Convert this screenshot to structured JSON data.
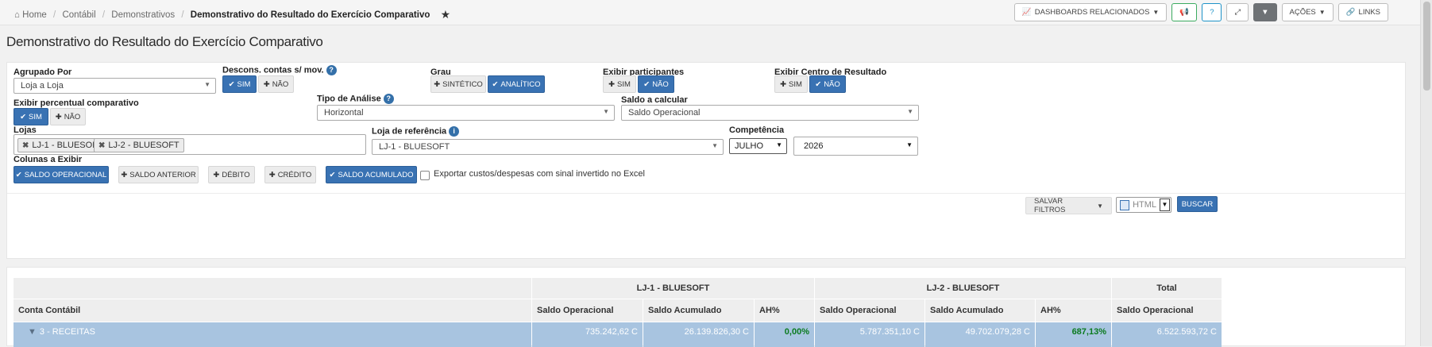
{
  "breadcrumb": {
    "home_icon": "home-icon",
    "items": [
      "Home",
      "Contábil",
      "Demonstrativos"
    ],
    "current": "Demonstrativo do Resultado do Exercício Comparativo",
    "star_icon": "star-icon"
  },
  "toolbar": {
    "dashboards_label": "DASHBOARDS RELACIONADOS",
    "acoes_label": "AÇÕES",
    "links_label": "LINKS"
  },
  "page_title": "Demonstrativo do Resultado do Exercício Comparativo",
  "filters": {
    "agrupado_por": {
      "label": "Agrupado Por",
      "value": "Loja a Loja"
    },
    "descons": {
      "label": "Descons. contas s/ mov.",
      "sim": "SIM",
      "nao": "NÃO",
      "selected": "SIM"
    },
    "grau": {
      "label": "Grau",
      "sintetico": "SINTÉTICO",
      "analitico": "ANALÍTICO",
      "selected": "ANALÍTICO"
    },
    "exibir_participantes": {
      "label": "Exibir participantes",
      "sim": "SIM",
      "nao": "NÃO",
      "selected": "NÃO"
    },
    "exibir_centro": {
      "label": "Exibir Centro de Resultado",
      "sim": "SIM",
      "nao": "NÃO",
      "selected": "NÃO"
    },
    "exibir_percentual": {
      "label": "Exibir percentual comparativo",
      "sim": "SIM",
      "nao": "NÃO",
      "selected": "SIM"
    },
    "tipo_analise": {
      "label": "Tipo de Análise",
      "value": "Horizontal"
    },
    "saldo_calcular": {
      "label": "Saldo a calcular",
      "value": "Saldo Operacional"
    },
    "lojas": {
      "label": "Lojas",
      "tags": [
        "LJ-1 - BLUESOFT",
        "LJ-2 - BLUESOFT"
      ]
    },
    "loja_referencia": {
      "label": "Loja de referência",
      "value": "LJ-1 - BLUESOFT"
    },
    "competencia": {
      "label": "Competência",
      "month": "JULHO",
      "year": "2026"
    },
    "colunas": {
      "label": "Colunas a Exibir",
      "items": [
        {
          "label": "SALDO OPERACIONAL",
          "active": true
        },
        {
          "label": "SALDO ANTERIOR",
          "active": false
        },
        {
          "label": "DÉBITO",
          "active": false
        },
        {
          "label": "CRÉDITO",
          "active": false
        },
        {
          "label": "SALDO ACUMULADO",
          "active": true
        }
      ]
    },
    "exportar_label": "Exportar custos/despesas com sinal invertido no Excel",
    "salvar_filtros": "SALVAR FILTROS",
    "format": "HTML",
    "buscar": "BUSCAR"
  },
  "table": {
    "groups": [
      "LJ-1 - BLUESOFT",
      "LJ-2 - BLUESOFT",
      "Total"
    ],
    "columns": [
      "Conta Contábil",
      "Saldo Operacional",
      "Saldo Acumulado",
      "AH%",
      "Saldo Operacional",
      "Saldo Acumulado",
      "AH%",
      "Saldo Operacional"
    ],
    "rows": [
      {
        "name": "3 - RECEITAS",
        "values": [
          "735.242,62 C",
          "26.139.826,30 C",
          "0,00%",
          "5.787.351,10 C",
          "49.702.079,28 C",
          "687,13%",
          "6.522.593,72 C"
        ]
      }
    ]
  },
  "colors": {
    "primary": "#3972b3",
    "row_highlight": "#a8c4e0",
    "positive": "#0a7a1e"
  }
}
